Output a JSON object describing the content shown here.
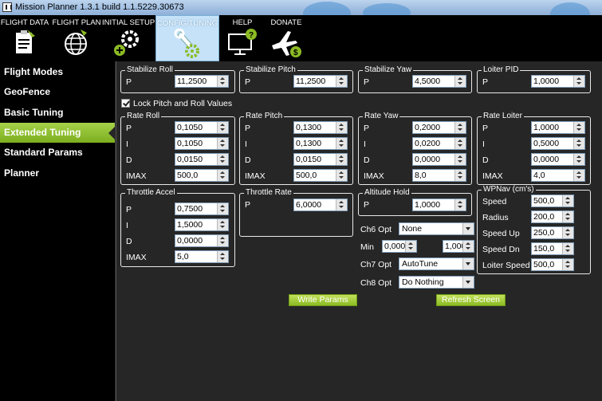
{
  "window": {
    "title": "Mission Planner 1.3.1 build 1.1.5229.30673"
  },
  "menu": [
    {
      "label": "FLIGHT DATA",
      "icon": "clipboard-plane-icon"
    },
    {
      "label": "FLIGHT PLAN",
      "icon": "globe-icon"
    },
    {
      "label": "INITIAL SETUP",
      "icon": "gears-plus-icon"
    },
    {
      "label": "CONFIG/TUNING",
      "icon": "wrench-gear-icon",
      "active": true
    },
    {
      "label": "HELP",
      "icon": "monitor-help-icon"
    },
    {
      "label": "DONATE",
      "icon": "plane-dollar-icon"
    }
  ],
  "sidebar": {
    "items": [
      {
        "label": "Flight Modes"
      },
      {
        "label": "GeoFence"
      },
      {
        "label": "Basic Tuning"
      },
      {
        "label": "Extended Tuning",
        "active": true
      },
      {
        "label": "Standard Params"
      },
      {
        "label": "Planner"
      }
    ]
  },
  "groups": {
    "stabilize_roll": {
      "title": "Stabilize Roll",
      "p_label": "P",
      "p": "11,2500"
    },
    "stabilize_pitch": {
      "title": "Stabilize Pitch",
      "p_label": "P",
      "p": "11,2500"
    },
    "stabilize_yaw": {
      "title": "Stabilize Yaw",
      "p_label": "P",
      "p": "4,5000"
    },
    "loiter_pid": {
      "title": "Loiter PID",
      "p_label": "P",
      "p": "1,0000"
    },
    "lock_pitch_roll": {
      "label": "Lock Pitch and Roll Values",
      "checked": true
    },
    "rate_roll": {
      "title": "Rate Roll",
      "labels": [
        "P",
        "I",
        "D",
        "IMAX"
      ],
      "values": [
        "0,1050",
        "0,1050",
        "0,0150",
        "500,0"
      ]
    },
    "rate_pitch": {
      "title": "Rate Pitch",
      "labels": [
        "P",
        "I",
        "D",
        "IMAX"
      ],
      "values": [
        "0,1300",
        "0,1300",
        "0,0150",
        "500,0"
      ]
    },
    "rate_yaw": {
      "title": "Rate Yaw",
      "labels": [
        "P",
        "I",
        "D",
        "IMAX"
      ],
      "values": [
        "0,2000",
        "0,0200",
        "0,0000",
        "8,0"
      ]
    },
    "rate_loiter": {
      "title": "Rate Loiter",
      "labels": [
        "P",
        "I",
        "D",
        "IMAX"
      ],
      "values": [
        "1,0000",
        "0,5000",
        "0,0000",
        "4,0"
      ]
    },
    "throttle_accel": {
      "title": "Throttle Accel",
      "labels": [
        "P",
        "I",
        "D",
        "IMAX"
      ],
      "values": [
        "0,7500",
        "1,5000",
        "0,0000",
        "5,0"
      ]
    },
    "throttle_rate": {
      "title": "Throttle Rate",
      "p_label": "P",
      "p": "6,0000"
    },
    "altitude_hold": {
      "title": "Altitude Hold",
      "p_label": "P",
      "p": "1,0000"
    },
    "wpnav": {
      "title": "WPNav (cm's)",
      "labels": [
        "Speed",
        "Radius",
        "Speed Up",
        "Speed Dn",
        "Loiter Speed"
      ],
      "values": [
        "500,0",
        "200,0",
        "250,0",
        "150,0",
        "500,0"
      ]
    }
  },
  "channels": {
    "ch6_label": "Ch6 Opt",
    "ch6_value": "None",
    "min_label": "Min",
    "min_value": "0,0000",
    "max_value": "1,000",
    "ch7_label": "Ch7 Opt",
    "ch7_value": "AutoTune",
    "ch8_label": "Ch8 Opt",
    "ch8_value": "Do Nothing"
  },
  "buttons": {
    "write_params": "Write Params",
    "refresh_screen": "Refresh Screen"
  },
  "colors": {
    "active_green": "#8cbb24",
    "menu_active": "#c5e2f8",
    "panel_bg": "#262626"
  }
}
